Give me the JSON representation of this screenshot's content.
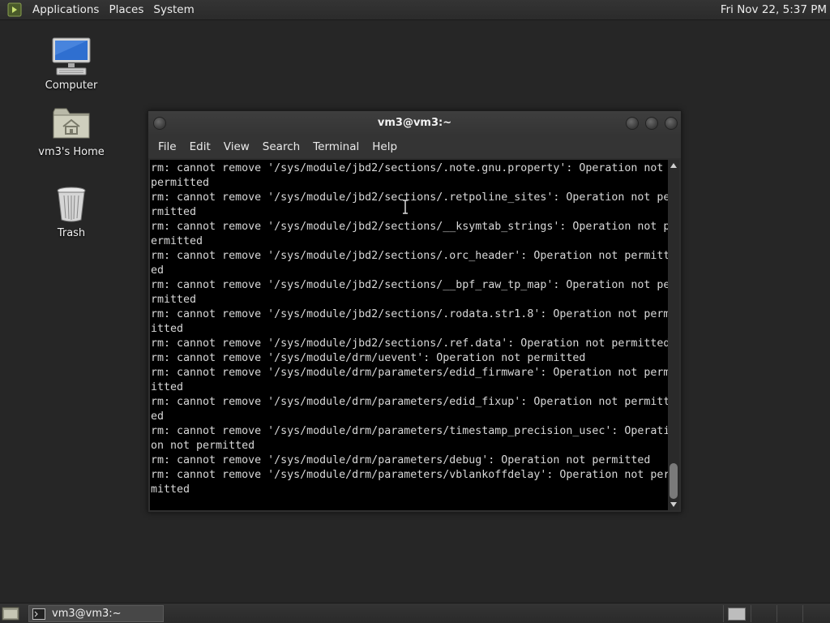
{
  "top_panel": {
    "menus": [
      "Applications",
      "Places",
      "System"
    ],
    "clock": "Fri Nov 22,  5:37 PM"
  },
  "desktop_icons": [
    {
      "label": "Computer",
      "icon": "computer-icon"
    },
    {
      "label": "vm3's Home",
      "icon": "home-folder-icon"
    },
    {
      "label": "Trash",
      "icon": "trash-icon"
    }
  ],
  "window": {
    "title": "vm3@vm3:~",
    "menu": [
      "File",
      "Edit",
      "View",
      "Search",
      "Terminal",
      "Help"
    ],
    "lines": [
      "rm: cannot remove '/sys/module/jbd2/sections/.note.gnu.property': Operation not",
      "permitted",
      "rm: cannot remove '/sys/module/jbd2/sections/.retpoline_sites': Operation not pe",
      "rmitted",
      "rm: cannot remove '/sys/module/jbd2/sections/__ksymtab_strings': Operation not p",
      "ermitted",
      "rm: cannot remove '/sys/module/jbd2/sections/.orc_header': Operation not permitt",
      "ed",
      "rm: cannot remove '/sys/module/jbd2/sections/__bpf_raw_tp_map': Operation not pe",
      "rmitted",
      "rm: cannot remove '/sys/module/jbd2/sections/.rodata.str1.8': Operation not perm",
      "itted",
      "rm: cannot remove '/sys/module/jbd2/sections/.ref.data': Operation not permitted",
      "rm: cannot remove '/sys/module/drm/uevent': Operation not permitted",
      "rm: cannot remove '/sys/module/drm/parameters/edid_firmware': Operation not perm",
      "itted",
      "rm: cannot remove '/sys/module/drm/parameters/edid_fixup': Operation not permitt",
      "ed",
      "rm: cannot remove '/sys/module/drm/parameters/timestamp_precision_usec': Operati",
      "on not permitted",
      "rm: cannot remove '/sys/module/drm/parameters/debug': Operation not permitted",
      "rm: cannot remove '/sys/module/drm/parameters/vblankoffdelay': Operation not per",
      "mitted"
    ]
  },
  "taskbar": {
    "task_label": "vm3@vm3:~"
  }
}
